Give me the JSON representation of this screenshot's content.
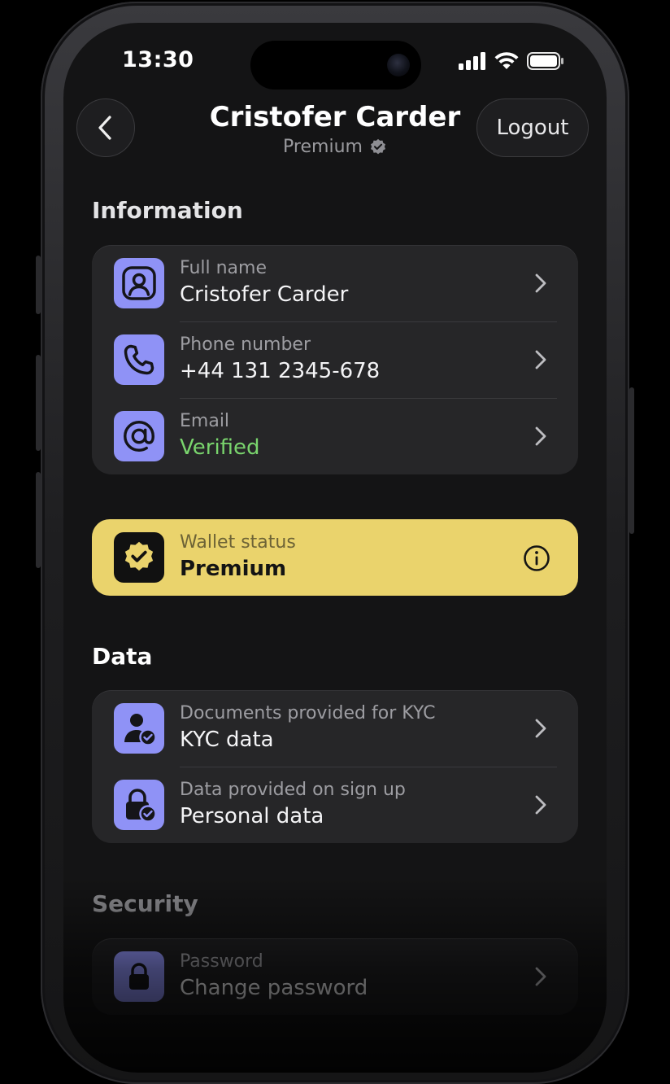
{
  "status_bar": {
    "time": "13:30"
  },
  "header": {
    "title": "Cristofer Carder",
    "subtitle": "Premium",
    "logout_label": "Logout"
  },
  "information": {
    "title": "Information",
    "rows": [
      {
        "label": "Full name",
        "value": "Cristofer Carder",
        "icon": "user-icon"
      },
      {
        "label": "Phone number",
        "value": "+44 131 2345-678",
        "icon": "phone-icon"
      },
      {
        "label": "Email",
        "value": "Verified",
        "icon": "at-sign-icon"
      }
    ]
  },
  "wallet": {
    "label": "Wallet status",
    "value": "Premium",
    "icon": "verified-badge-icon"
  },
  "data_section": {
    "title": "Data",
    "rows": [
      {
        "label": "Documents provided for KYC",
        "value": "KYC data",
        "icon": "user-check-icon"
      },
      {
        "label": "Data provided on sign up",
        "value": "Personal data",
        "icon": "lock-check-icon"
      }
    ]
  },
  "security": {
    "title": "Security",
    "rows": [
      {
        "label": "Password",
        "value": "Change password",
        "icon": "lock-icon"
      }
    ]
  },
  "colors": {
    "background": "#141415",
    "card": "#262628",
    "accent_purple": "#8f92f6",
    "wallet_yellow": "#ead36c",
    "verified_green": "#79d46d"
  }
}
